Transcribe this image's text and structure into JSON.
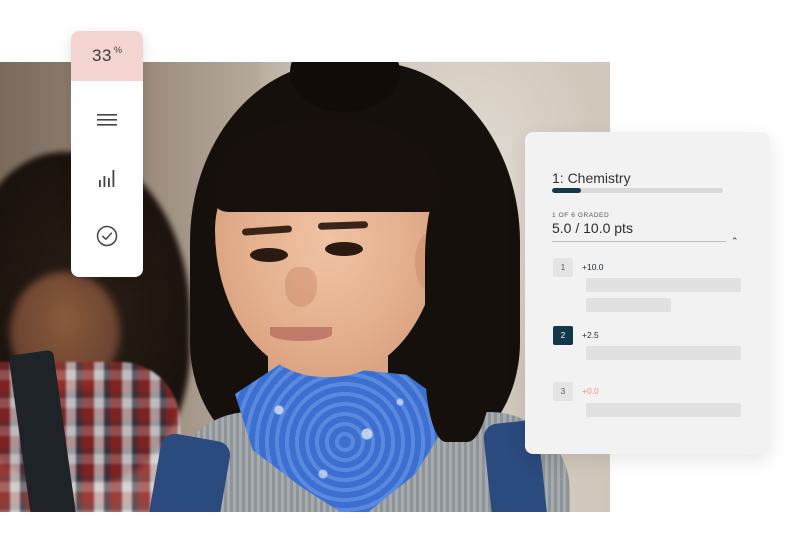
{
  "toolbar": {
    "progress_value": "33",
    "progress_unit": "%",
    "items": [
      {
        "icon": "menu-icon"
      },
      {
        "icon": "bar-chart-icon"
      },
      {
        "icon": "check-circle-icon"
      }
    ]
  },
  "grading_card": {
    "title": "1: Chemistry",
    "title_progress_fraction": 0.17,
    "graded_status": "1 OF 6 GRADED",
    "score": "5.0 / 10.0 pts",
    "collapse_icon": "chevron-up-icon",
    "questions": [
      {
        "number": "1",
        "points": "+10.0",
        "active": false
      },
      {
        "number": "2",
        "points": "+2.5",
        "active": true
      },
      {
        "number": "3",
        "points": "+0.0",
        "active": false
      }
    ]
  },
  "colors": {
    "accent_navy": "#12384a",
    "progress_pink": "#f3d4d1",
    "zero_points": "#f0927d",
    "card_bg": "#f2f2f2"
  }
}
